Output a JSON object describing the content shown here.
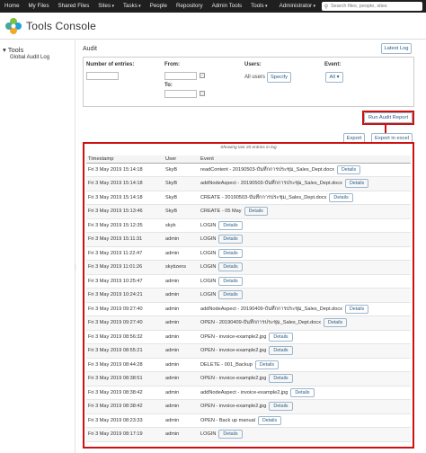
{
  "topnav": {
    "items": [
      "Home",
      "My Files",
      "Shared Files",
      "Sites",
      "Tasks",
      "People",
      "Repository",
      "Admin Tools",
      "Tools"
    ],
    "carets": [
      false,
      false,
      false,
      true,
      true,
      false,
      false,
      false,
      true
    ],
    "user": "Administrator",
    "search_placeholder": "Search files, people, sites"
  },
  "header": {
    "title": "Tools Console"
  },
  "sidebar": {
    "title": "Tools",
    "item": "Global Audit Log"
  },
  "audit": {
    "title": "Audit",
    "latest_log": "Latest Log",
    "labels": {
      "entries": "Number of entries:",
      "from": "From:",
      "to": "To:",
      "users": "Users:",
      "event": "Event:"
    },
    "all_users": "All users",
    "specify": "Specify",
    "all": "All",
    "run": "Run Audit Report",
    "export": "Export",
    "export_excel": "Export in excel",
    "caption": "Showing last 20 entries in log"
  },
  "table": {
    "headers": [
      "Timestamp",
      "User",
      "Event"
    ],
    "details_label": "Details",
    "rows": [
      {
        "ts": "Fri 3 May 2019 15:14:18",
        "user": "SkyB",
        "event": "readContent - 20190503-บันทึกการประชุม_Sales_Dept.docx"
      },
      {
        "ts": "Fri 3 May 2019 15:14:18",
        "user": "SkyB",
        "event": "addNodeAspect - 20190503-บันทึกการประชุม_Sales_Dept.docx"
      },
      {
        "ts": "Fri 3 May 2019 15:14:18",
        "user": "SkyB",
        "event": "CREATE - 20190503-บันทึกการประชุม_Sales_Dept.docx"
      },
      {
        "ts": "Fri 3 May 2019 15:13:46",
        "user": "SkyB",
        "event": "CREATE - 05 May"
      },
      {
        "ts": "Fri 3 May 2019 15:12:35",
        "user": "skyb",
        "event": "LOGIN"
      },
      {
        "ts": "Fri 3 May 2019 15:11:31",
        "user": "admin",
        "event": "LOGIN"
      },
      {
        "ts": "Fri 3 May 2019 11:22:47",
        "user": "admin",
        "event": "LOGIN"
      },
      {
        "ts": "Fri 3 May 2019 11:01:26",
        "user": "skytizens",
        "event": "LOGIN"
      },
      {
        "ts": "Fri 3 May 2019 10:25:47",
        "user": "admin",
        "event": "LOGIN"
      },
      {
        "ts": "Fri 3 May 2019 10:24:21",
        "user": "admin",
        "event": "LOGIN"
      },
      {
        "ts": "Fri 3 May 2019 09:27:40",
        "user": "admin",
        "event": "addNodeAspect - 20190409-บันทึกการประชุม_Sales_Dept.docx"
      },
      {
        "ts": "Fri 3 May 2019 09:27:40",
        "user": "admin",
        "event": "OPEN - 20190409-บันทึกการประชุม_Sales_Dept.docx"
      },
      {
        "ts": "Fri 3 May 2019 08:56:32",
        "user": "admin",
        "event": "OPEN - invoice-example2.jpg"
      },
      {
        "ts": "Fri 3 May 2019 08:55:21",
        "user": "admin",
        "event": "OPEN - invoice-example2.jpg"
      },
      {
        "ts": "Fri 3 May 2019 08:44:28",
        "user": "admin",
        "event": "DELETE - 001_Backup"
      },
      {
        "ts": "Fri 3 May 2019 08:38:51",
        "user": "admin",
        "event": "OPEN - invoice-example2.jpg"
      },
      {
        "ts": "Fri 3 May 2019 08:38:42",
        "user": "admin",
        "event": "addNodeAspect - invoice-example2.jpg"
      },
      {
        "ts": "Fri 3 May 2019 08:38:42",
        "user": "admin",
        "event": "OPEN - invoice-example2.jpg"
      },
      {
        "ts": "Fri 3 May 2019 08:23:33",
        "user": "admin",
        "event": "OPEN - Back up manual"
      },
      {
        "ts": "Fri 3 May 2019 08:17:19",
        "user": "admin",
        "event": "LOGIN"
      }
    ]
  },
  "colors": {
    "nav_bg": "#1f1f1f",
    "highlight": "#cc1111",
    "button_text": "#2b5d86"
  }
}
